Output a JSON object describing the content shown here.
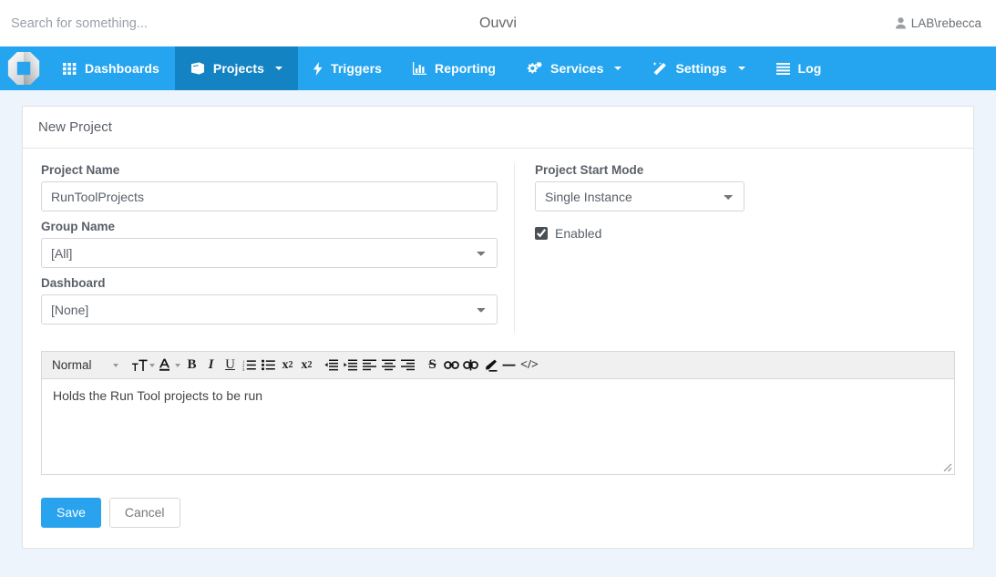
{
  "topbar": {
    "search_placeholder": "Search for something...",
    "search_value": "",
    "app_title": "Ouvvi",
    "user": "LAB\\rebecca"
  },
  "nav": {
    "brand_icon": "ouvvi-logo",
    "items": [
      {
        "label": "Dashboards",
        "icon": "grid-icon",
        "caret": false,
        "active": false
      },
      {
        "label": "Projects",
        "icon": "book-icon",
        "caret": true,
        "active": true
      },
      {
        "label": "Triggers",
        "icon": "bolt-icon",
        "caret": false,
        "active": false
      },
      {
        "label": "Reporting",
        "icon": "bar-chart-icon",
        "caret": false,
        "active": false
      },
      {
        "label": "Services",
        "icon": "cogs-icon",
        "caret": true,
        "active": false
      },
      {
        "label": "Settings",
        "icon": "magic-wand-icon",
        "caret": true,
        "active": false
      },
      {
        "label": "Log",
        "icon": "list-icon",
        "caret": false,
        "active": false
      }
    ]
  },
  "panel": {
    "title": "New Project"
  },
  "form": {
    "project_name_label": "Project Name",
    "project_name_value": "RunToolProjects",
    "project_name_placeholder": "",
    "group_name_label": "Group Name",
    "group_name_value": "[All]",
    "group_name_options": [
      "[All]"
    ],
    "dashboard_label": "Dashboard",
    "dashboard_value": "[None]",
    "dashboard_options": [
      "[None]"
    ],
    "start_mode_label": "Project Start Mode",
    "start_mode_value": "Single Instance",
    "start_mode_options": [
      "Single Instance"
    ],
    "enabled_label": "Enabled",
    "enabled_checked": true
  },
  "editor": {
    "style_label": "Normal",
    "content": "Holds the Run Tool projects to be run",
    "tools": [
      {
        "name": "font-size-icon",
        "glyph": "tT"
      },
      {
        "name": "text-color-icon",
        "glyph": "A"
      },
      {
        "name": "bold-icon",
        "glyph": "B"
      },
      {
        "name": "italic-icon",
        "glyph": "I"
      },
      {
        "name": "underline-icon",
        "glyph": "U"
      },
      {
        "name": "ordered-list-icon",
        "glyph": "1."
      },
      {
        "name": "unordered-list-icon",
        "glyph": "•"
      },
      {
        "name": "subscript-icon",
        "glyph": "x2"
      },
      {
        "name": "superscript-icon",
        "glyph": "x2"
      },
      {
        "name": "outdent-icon",
        "glyph": "<"
      },
      {
        "name": "indent-icon",
        "glyph": ">"
      },
      {
        "name": "align-left-icon",
        "glyph": "≡"
      },
      {
        "name": "align-center-icon",
        "glyph": "≡"
      },
      {
        "name": "align-right-icon",
        "glyph": "≡"
      },
      {
        "name": "strikethrough-icon",
        "glyph": "S"
      },
      {
        "name": "link-icon",
        "glyph": "∞"
      },
      {
        "name": "unlink-icon",
        "glyph": "∞"
      },
      {
        "name": "highlight-pen-icon",
        "glyph": "/"
      },
      {
        "name": "horizontal-rule-icon",
        "glyph": "—"
      },
      {
        "name": "code-view-icon",
        "glyph": "<>"
      }
    ]
  },
  "buttons": {
    "save_label": "Save",
    "cancel_label": "Cancel"
  },
  "colors": {
    "nav_blue": "#25a5ef",
    "nav_active_blue": "#1483c4",
    "primary_button": "#2aa3ef",
    "page_background": "#edf4fc"
  }
}
